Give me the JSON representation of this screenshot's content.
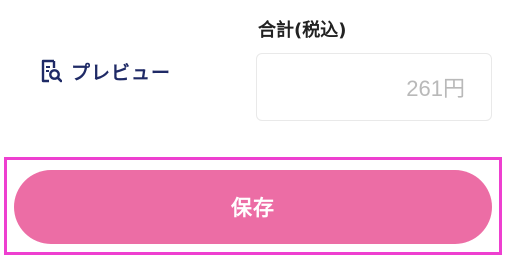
{
  "preview": {
    "label": "プレビュー",
    "icon": "document-search-icon",
    "color": "#1f2a66"
  },
  "total": {
    "label": "合計(税込)",
    "value": "261円"
  },
  "save_button": {
    "label": "保存",
    "color": "#ec6da5"
  },
  "highlight": {
    "color": "#ee3fd0"
  }
}
